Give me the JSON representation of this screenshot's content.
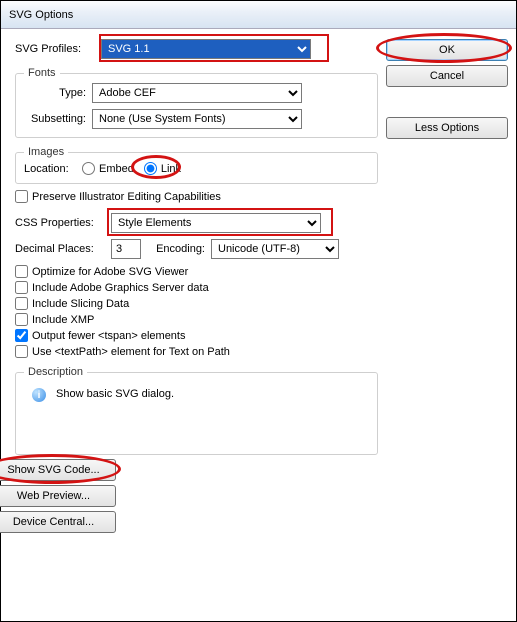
{
  "window": {
    "title": "SVG Options"
  },
  "profiles": {
    "label": "SVG Profiles:",
    "value": "SVG 1.1"
  },
  "fonts": {
    "legend": "Fonts",
    "type_label": "Type:",
    "type_value": "Adobe CEF",
    "subsetting_label": "Subsetting:",
    "subsetting_value": "None (Use System Fonts)"
  },
  "images": {
    "legend": "Images",
    "location_label": "Location:",
    "embed_label": "Embed",
    "link_label": "Link"
  },
  "preserve": {
    "label": "Preserve Illustrator Editing Capabilities"
  },
  "css": {
    "label": "CSS Properties:",
    "value": "Style Elements"
  },
  "decimal": {
    "label": "Decimal Places:",
    "value": "3"
  },
  "encoding": {
    "label": "Encoding:",
    "value": "Unicode (UTF-8)"
  },
  "checks": {
    "optimize": "Optimize for Adobe SVG Viewer",
    "graphics_server": "Include Adobe Graphics Server data",
    "slicing": "Include Slicing Data",
    "xmp": "Include XMP",
    "tspan": "Output fewer <tspan> elements",
    "textpath": "Use <textPath> element for Text on Path"
  },
  "description": {
    "legend": "Description",
    "text": "Show basic SVG dialog."
  },
  "buttons": {
    "ok": "OK",
    "cancel": "Cancel",
    "less": "Less Options",
    "show_code": "Show SVG Code...",
    "web_preview": "Web Preview...",
    "device_central": "Device Central..."
  }
}
